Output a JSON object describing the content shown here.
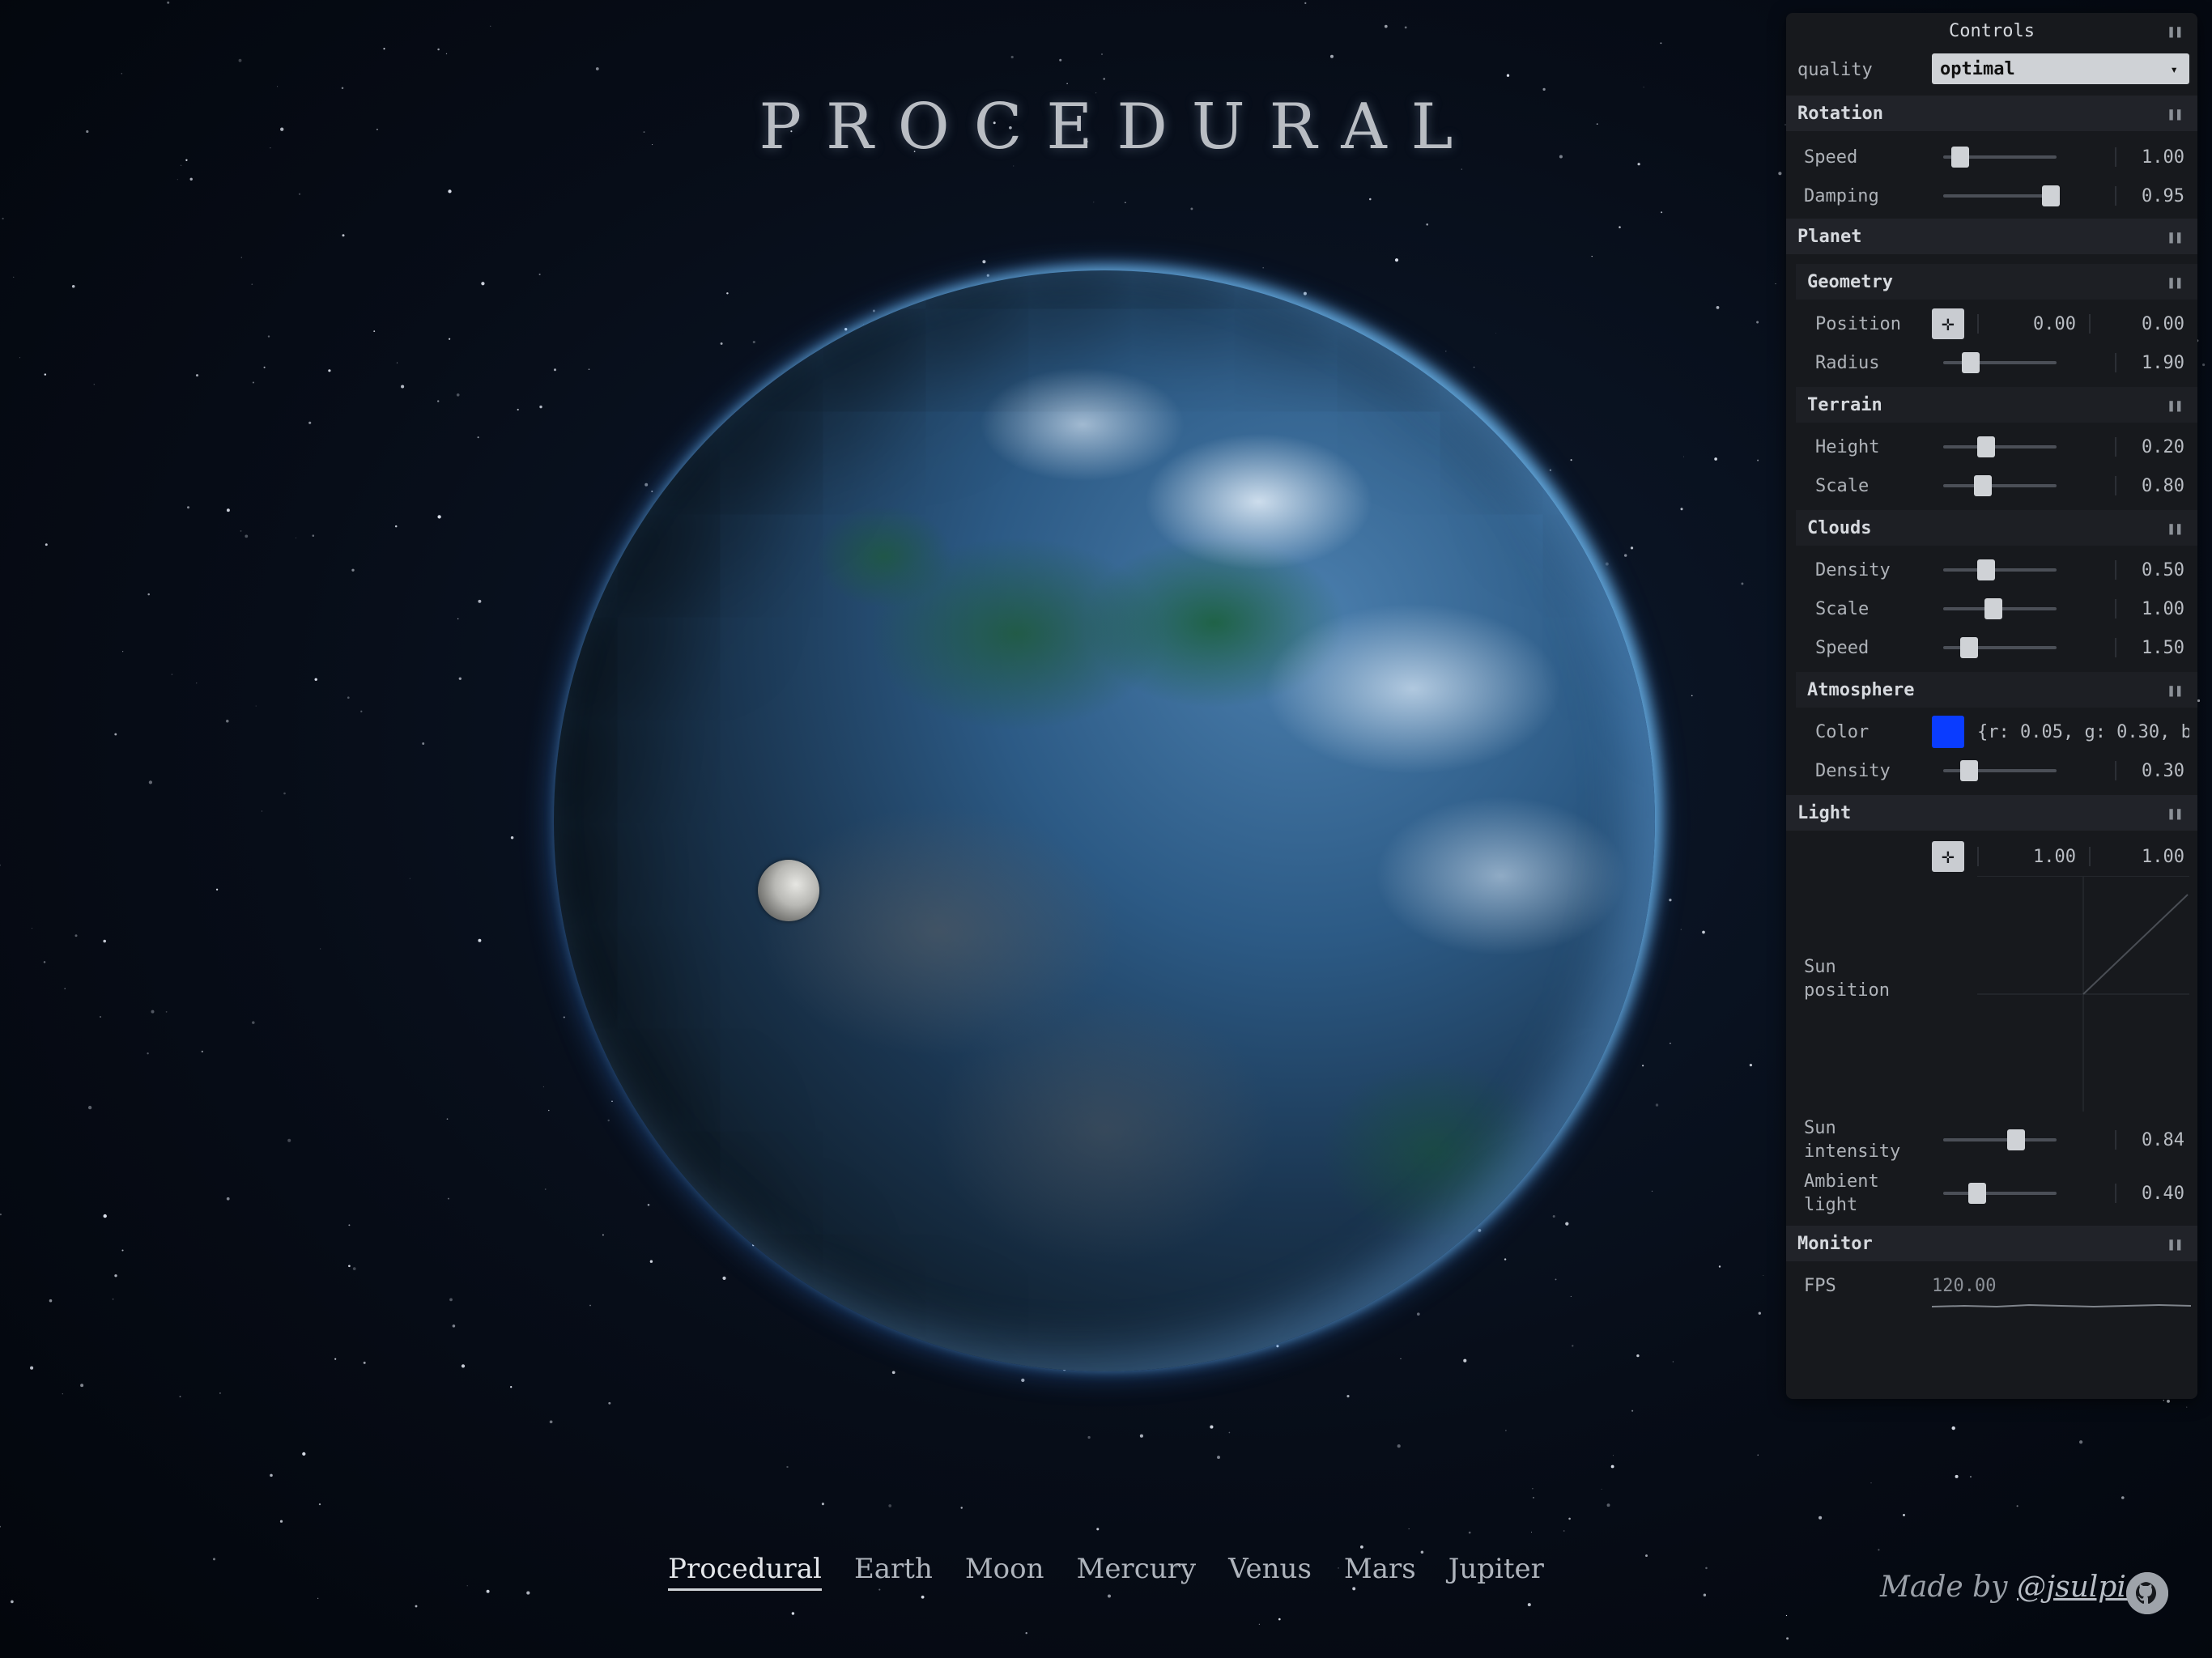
{
  "title": "PROCEDURAL",
  "nav": {
    "items": [
      "Procedural",
      "Earth",
      "Moon",
      "Mercury",
      "Venus",
      "Mars",
      "Jupiter"
    ],
    "active": "Procedural"
  },
  "footer": {
    "made_by": "Made by",
    "handle": "@jsulpis",
    "github_icon": "github-icon"
  },
  "controls": {
    "title": "Controls",
    "quality": {
      "label": "quality",
      "value": "optimal"
    },
    "rotation": {
      "title": "Rotation",
      "speed": {
        "label": "Speed",
        "value": "1.00",
        "level": 0.15
      },
      "damping": {
        "label": "Damping",
        "value": "0.95",
        "level": 0.95
      }
    },
    "planet": {
      "title": "Planet",
      "geometry": {
        "title": "Geometry",
        "position": {
          "label": "Position",
          "x": "0.00",
          "y": "0.00"
        },
        "radius": {
          "label": "Radius",
          "value": "1.90",
          "level": 0.24
        }
      },
      "terrain": {
        "title": "Terrain",
        "height": {
          "label": "Height",
          "value": "0.20",
          "level": 0.38
        },
        "scale": {
          "label": "Scale",
          "value": "0.80",
          "level": 0.35
        }
      },
      "clouds": {
        "title": "Clouds",
        "density": {
          "label": "Density",
          "value": "0.50",
          "level": 0.38
        },
        "scale": {
          "label": "Scale",
          "value": "1.00",
          "level": 0.44
        },
        "speed": {
          "label": "Speed",
          "value": "1.50",
          "level": 0.23
        }
      },
      "atmosphere": {
        "title": "Atmosphere",
        "color": {
          "label": "Color",
          "value": "{r: 0.05, g: 0.30, b",
          "swatch": "#0a3cff"
        },
        "density": {
          "label": "Density",
          "value": "0.30",
          "level": 0.23
        }
      }
    },
    "light": {
      "title": "Light",
      "sun_position": {
        "label": "Sun position",
        "x": "1.00",
        "y": "1.00"
      },
      "sun_intensity": {
        "label": "Sun intensity",
        "value": "0.84",
        "level": 0.64
      },
      "ambient_light": {
        "label": "Ambient light",
        "value": "0.40",
        "level": 0.3
      }
    },
    "monitor": {
      "title": "Monitor",
      "fps": {
        "label": "FPS",
        "value": "120.00"
      }
    }
  }
}
